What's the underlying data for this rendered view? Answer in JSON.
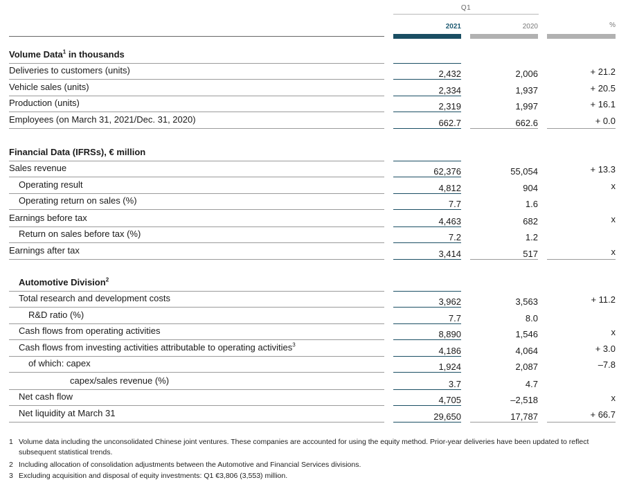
{
  "header": {
    "period": "Q1",
    "col_2021": "2021",
    "col_2020": "2020",
    "col_pct": "%"
  },
  "sections": {
    "volume_title": "Volume Data",
    "volume_sup": "1",
    "volume_suffix": " in thousands",
    "financial_title": "Financial Data (IFRSs), € million",
    "auto_title": "Automotive Division",
    "auto_sup": "2"
  },
  "rows": [
    {
      "label": "Deliveries to customers (units)",
      "v2021": "2,432",
      "v2020": "2,006",
      "pct": "+ 21.2"
    },
    {
      "label": "Vehicle sales (units)",
      "v2021": "2,334",
      "v2020": "1,937",
      "pct": "+ 20.5"
    },
    {
      "label": "Production (units)",
      "v2021": "2,319",
      "v2020": "1,997",
      "pct": "+ 16.1"
    },
    {
      "label": "Employees (on March 31, 2021/Dec. 31, 2020)",
      "v2021": "662.7",
      "v2020": "662.6",
      "pct": "+ 0.0"
    },
    {
      "label": "Sales revenue",
      "v2021": "62,376",
      "v2020": "55,054",
      "pct": "+ 13.3"
    },
    {
      "label": "Operating result",
      "v2021": "4,812",
      "v2020": "904",
      "pct": "x"
    },
    {
      "label": "Operating return on sales (%)",
      "v2021": "7.7",
      "v2020": "1.6",
      "pct": ""
    },
    {
      "label": "Earnings before tax",
      "v2021": "4,463",
      "v2020": "682",
      "pct": "x"
    },
    {
      "label": "Return on sales before tax (%)",
      "v2021": "7.2",
      "v2020": "1.2",
      "pct": ""
    },
    {
      "label": "Earnings after tax",
      "v2021": "3,414",
      "v2020": "517",
      "pct": "x"
    },
    {
      "label": "Total research and development costs",
      "v2021": "3,962",
      "v2020": "3,563",
      "pct": "+ 11.2"
    },
    {
      "label": "R&D ratio (%)",
      "v2021": "7.7",
      "v2020": "8.0",
      "pct": ""
    },
    {
      "label": "Cash flows from operating activities",
      "v2021": "8,890",
      "v2020": "1,546",
      "pct": "x"
    },
    {
      "label": "Cash flows from investing activities attributable to operating activities",
      "sup": "3",
      "v2021": "4,186",
      "v2020": "4,064",
      "pct": "+ 3.0"
    },
    {
      "label": "of which: capex",
      "v2021": "1,924",
      "v2020": "2,087",
      "pct": "–7.8"
    },
    {
      "label": "capex/sales revenue (%)",
      "v2021": "3.7",
      "v2020": "4.7",
      "pct": ""
    },
    {
      "label": "Net cash flow",
      "v2021": "4,705",
      "v2020": "–2,518",
      "pct": "x"
    },
    {
      "label": "Net liquidity at March 31",
      "v2021": "29,650",
      "v2020": "17,787",
      "pct": "+ 66.7"
    }
  ],
  "footnotes": [
    {
      "n": "1",
      "text": "Volume data including the unconsolidated Chinese joint ventures. These companies are accounted for using the equity method. Prior-year deliveries have been updated to reflect subsequent statistical trends."
    },
    {
      "n": "2",
      "text": "Including allocation of consolidation adjustments between the Automotive and Financial Services divisions."
    },
    {
      "n": "3",
      "text": "Excluding acquisition and disposal of equity investments: Q1 €3,806 (3,553) million."
    }
  ]
}
